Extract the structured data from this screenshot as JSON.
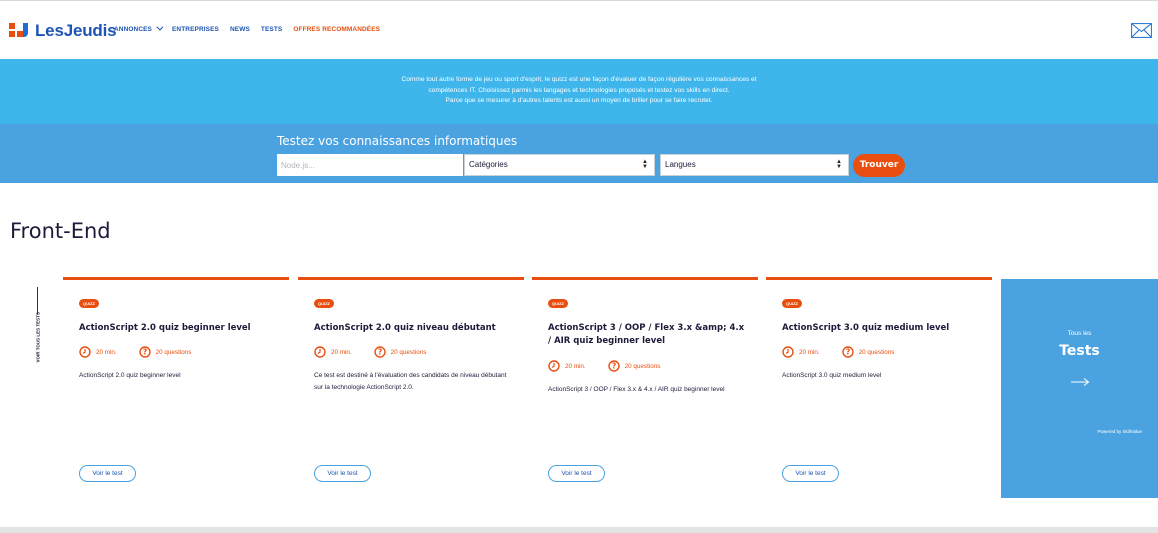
{
  "header": {
    "logo_text": "LesJeudis",
    "nav": [
      {
        "label": "ANNONCES"
      },
      {
        "label": "ENTREPRISES"
      },
      {
        "label": "NEWS"
      },
      {
        "label": "TESTS"
      },
      {
        "label": "OFFRES RECOMMANDÉES"
      }
    ]
  },
  "banner": {
    "lines": [
      "Comme tout autre forme de jeu ou sport d'esprit, le quizz est une façon d'évaluer de façon régulière vos connaissances et",
      "compétences IT. Choisissez parmis les langages et technologies proposés et testez vos skills en direct.",
      "Parce que se mesurer à d'autres talents est aussi un moyen de briller pour se faire recruter."
    ]
  },
  "search": {
    "title": "Testez vos connaissances informatiques",
    "placeholder": "Node.js...",
    "category_value": "Catégories",
    "language_value": "Langues",
    "button_label": "Trouver"
  },
  "section": {
    "title": "Front-End",
    "side_label": "VOIR TOUS LES TESTS"
  },
  "cards": [
    {
      "badge": "QUIZZ",
      "title": "ActionScript 2.0 quiz beginner level",
      "duration": "20 min.",
      "questions": "20 questions",
      "description": "ActionScript 2.0 quiz beginner level",
      "button": "Voir le test"
    },
    {
      "badge": "QUIZZ",
      "title": "ActionScript 2.0 quiz niveau débutant",
      "duration": "20 min.",
      "questions": "20 questions",
      "description": "Ce test est destiné à l'évaluation des candidats de niveau débutant sur la technologie ActionScript 2.0.",
      "button": "Voir le test"
    },
    {
      "badge": "QUIZZ",
      "title": "ActionScript 3 / OOP / Flex 3.x &amp; 4.x / AIR quiz beginner level",
      "duration": "20 min.",
      "questions": "20 questions",
      "description": "ActionScript 3 / OOP / Flex 3.x & 4.x / AIR quiz beginner level",
      "button": "Voir le test"
    },
    {
      "badge": "QUIZZ",
      "title": "ActionScript 3.0 quiz medium level",
      "duration": "20 min.",
      "questions": "20 questions",
      "description": "ActionScript 3.0 quiz medium level",
      "button": "Voir le test"
    }
  ],
  "promo": {
    "small": "Tous les",
    "big": "Tests",
    "powered": "Powered by SkillValue"
  },
  "colors": {
    "brand_orange": "#e84e0f",
    "brand_blue": "#1c55b5",
    "banner_blue": "#3eb5eb",
    "search_blue": "#4aa3e0"
  }
}
